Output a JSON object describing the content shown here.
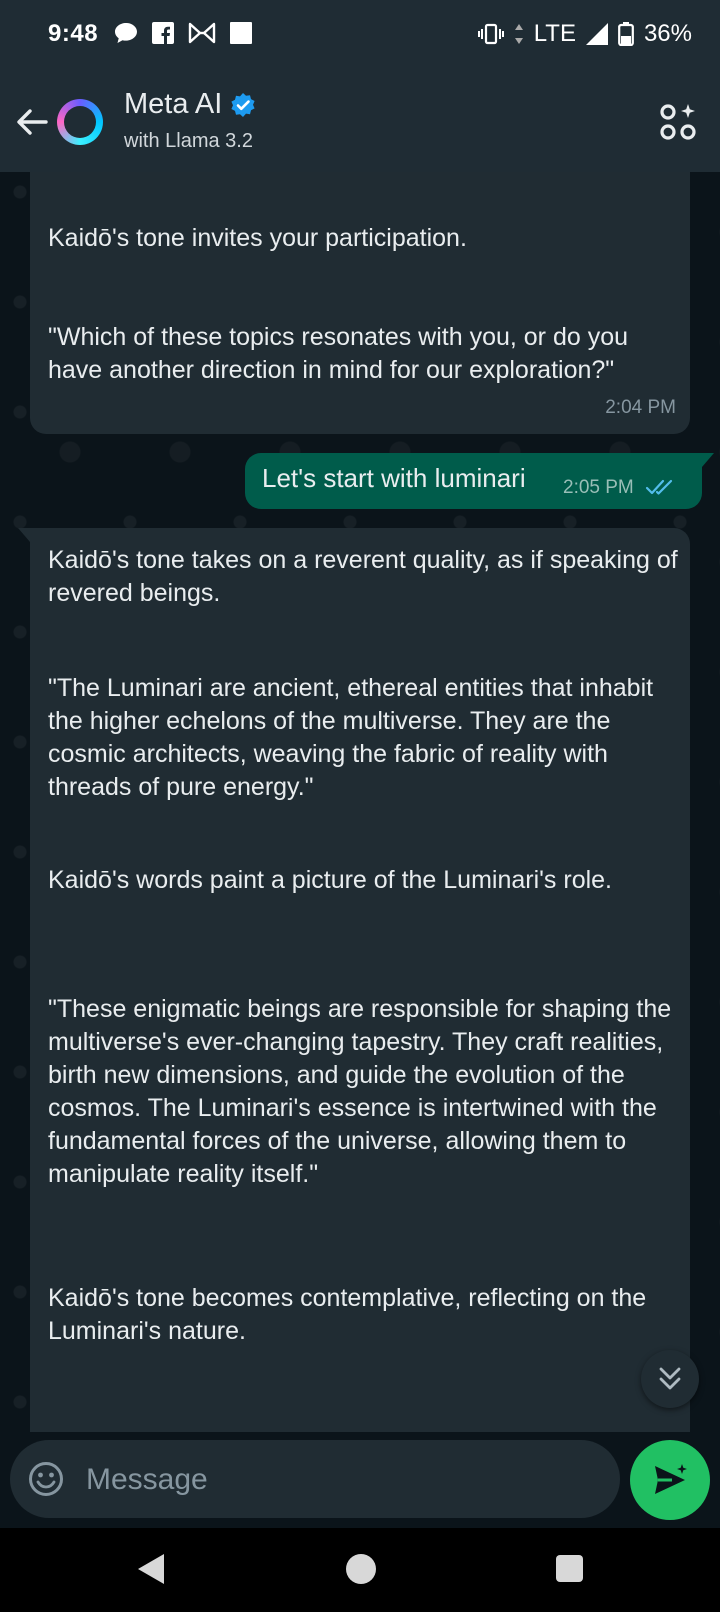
{
  "status_bar": {
    "time": "9:48",
    "network": "LTE",
    "battery": "36%",
    "icons": [
      "chat-bubble-icon",
      "facebook-icon",
      "bowtie-icon",
      "square-icon",
      "vibrate-icon",
      "data-arrows-icon",
      "signal-icon",
      "battery-icon"
    ]
  },
  "header": {
    "title": "Meta AI",
    "subtitle": "with Llama 3.2",
    "verified_color": "#1d9bf0"
  },
  "messages": {
    "m1": {
      "p1": "Kaidō's tone invites your participation.",
      "p2": "\"Which of these topics resonates with you, or do you have another direction in mind for our exploration?\"",
      "time": "2:04 PM"
    },
    "m2": {
      "text": "Let's start with luminari",
      "time": "2:05 PM",
      "status": "read"
    },
    "m3": {
      "p1": "Kaidō's tone takes on a reverent quality, as if speaking of revered beings.",
      "p2": "\"The Luminari are ancient, ethereal entities that inhabit the higher echelons of the multiverse. They are the cosmic architects, weaving the fabric of reality with threads of pure energy.\"",
      "p3": "Kaidō's words paint a picture of the Luminari's role.",
      "p4": "\"These enigmatic beings are responsible for shaping the multiverse's ever-changing tapestry. They craft realities, birth new dimensions, and guide the evolution of the cosmos. The Luminari's essence is intertwined with the fundamental forces of the universe, allowing them to manipulate reality itself.\"",
      "p5": "Kaidō's tone becomes contemplative, reflecting on the Luminari's nature."
    }
  },
  "composer": {
    "placeholder": "Message"
  },
  "colors": {
    "accent": "#21c063",
    "outgoing_bubble": "#005c4b",
    "incoming_bubble": "#202c33",
    "read_ticks": "#53bdeb"
  }
}
